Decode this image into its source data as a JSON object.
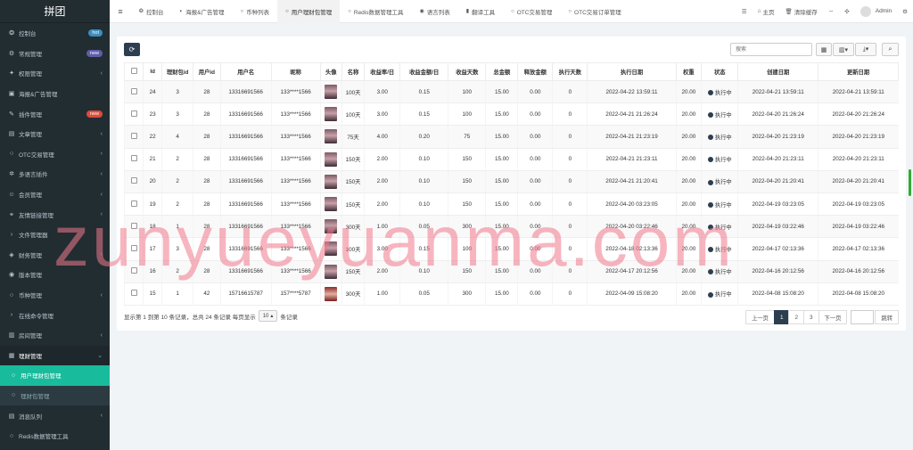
{
  "brand": "拼团",
  "sidebar": [
    {
      "icon": "dashboard-icon",
      "glyph": "❂",
      "label": "控制台",
      "badge": "hot",
      "badge_color": "#3c8dbc",
      "chev": ""
    },
    {
      "icon": "gear-icon",
      "glyph": "⚙",
      "label": "常规管理",
      "badge": "new",
      "badge_color": "#605ca8",
      "chev": ""
    },
    {
      "icon": "group-icon",
      "glyph": "✦",
      "label": "权限管理",
      "badge": "",
      "chev": "‹"
    },
    {
      "icon": "ad-icon",
      "glyph": "▣",
      "label": "海报&广告管理",
      "badge": "",
      "chev": ""
    },
    {
      "icon": "plug-icon",
      "glyph": "✎",
      "label": "插件管理",
      "badge": "new",
      "badge_color": "#dd4b39",
      "chev": ""
    },
    {
      "icon": "file-icon",
      "glyph": "▤",
      "label": "文章管理",
      "badge": "",
      "chev": "‹"
    },
    {
      "icon": "circle-icon",
      "glyph": "○",
      "label": "OTC交易管理",
      "badge": "",
      "chev": "‹"
    },
    {
      "icon": "translate-icon",
      "glyph": "✲",
      "label": "多语言插件",
      "badge": "",
      "chev": "‹"
    },
    {
      "icon": "user-icon",
      "glyph": "☺",
      "label": "会员管理",
      "badge": "",
      "chev": "‹"
    },
    {
      "icon": "link-icon",
      "glyph": "⚭",
      "label": "友情链接管理",
      "badge": "",
      "chev": "‹"
    },
    {
      "icon": "folder-icon",
      "glyph": "›",
      "label": "文件管理器",
      "badge": "",
      "chev": ""
    },
    {
      "icon": "wallet-icon",
      "glyph": "◈",
      "label": "财务管理",
      "badge": "",
      "chev": "‹"
    },
    {
      "icon": "version-icon",
      "glyph": "◉",
      "label": "版本管理",
      "badge": "",
      "chev": ""
    },
    {
      "icon": "coin-icon",
      "glyph": "○",
      "label": "币种管理",
      "badge": "",
      "chev": "‹"
    },
    {
      "icon": "terminal-icon",
      "glyph": "›",
      "label": "在线命令管理",
      "badge": "",
      "chev": ""
    },
    {
      "icon": "house-icon",
      "glyph": "▥",
      "label": "房间管理",
      "badge": "",
      "chev": "‹"
    },
    {
      "icon": "finance-icon",
      "glyph": "▦",
      "label": "理财管理",
      "badge": "",
      "chev": "⌄",
      "cls": "header-open"
    },
    {
      "icon": "circle-icon",
      "glyph": "○",
      "label": "用户理财包管理",
      "badge": "",
      "chev": "",
      "cls": "sub active"
    },
    {
      "icon": "circle-icon",
      "glyph": "○",
      "label": "理财包管理",
      "badge": "",
      "chev": "",
      "cls": "sub"
    },
    {
      "icon": "queue-icon",
      "glyph": "▤",
      "label": "消息队列",
      "badge": "",
      "chev": "‹"
    },
    {
      "icon": "circle-icon",
      "glyph": "○",
      "label": "Redis数据管理工具",
      "badge": "",
      "chev": ""
    }
  ],
  "tabs": [
    {
      "icon": "dashboard-icon",
      "glyph": "❂",
      "label": "控制台"
    },
    {
      "icon": "ad-icon",
      "glyph": "◐",
      "label": "海报&广告管理"
    },
    {
      "icon": "circle-icon",
      "glyph": "○",
      "label": "币种列表"
    },
    {
      "icon": "circle-icon",
      "glyph": "○",
      "label": "用户理财包管理",
      "active": true
    },
    {
      "icon": "circle-icon",
      "glyph": "○",
      "label": "Redis数据管理工具"
    },
    {
      "icon": "translate-icon",
      "glyph": "◉",
      "label": "语言列表"
    },
    {
      "icon": "book-icon",
      "glyph": "▮",
      "label": "翻译工具"
    },
    {
      "icon": "circle-icon",
      "glyph": "○",
      "label": "OTC交易管理"
    },
    {
      "icon": "circle-icon",
      "glyph": "○",
      "label": "OTC交易订单管理"
    }
  ],
  "topright": {
    "menu_glyph": "☰",
    "home": "主页",
    "clear": "清除缓存",
    "user": "Admin"
  },
  "search_placeholder": "搜索",
  "columns": [
    "Id",
    "理财包id",
    "用户id",
    "用户名",
    "昵称",
    "头像",
    "名称",
    "收益率/日",
    "收益金额/日",
    "收益天数",
    "总金额",
    "释放金额",
    "执行天数",
    "执行日期",
    "权重",
    "状态",
    "创建日期",
    "更新日期"
  ],
  "rows": [
    [
      "24",
      "3",
      "28",
      "13316691566",
      "133****1566",
      "",
      "100天",
      "3.00",
      "0.15",
      "100",
      "15.00",
      "0.00",
      "0",
      "2022-04-22 13:59:11",
      "20.00",
      "执行中",
      "2022-04-21 13:59:11",
      "2022-04-21 13:59:11"
    ],
    [
      "23",
      "3",
      "28",
      "13316691566",
      "133****1566",
      "",
      "100天",
      "3.00",
      "0.15",
      "100",
      "15.00",
      "0.00",
      "0",
      "2022-04-21 21:26:24",
      "20.00",
      "执行中",
      "2022-04-20 21:26:24",
      "2022-04-20 21:26:24"
    ],
    [
      "22",
      "4",
      "28",
      "13316691566",
      "133****1566",
      "",
      "75天",
      "4.00",
      "0.20",
      "75",
      "15.00",
      "0.00",
      "0",
      "2022-04-21 21:23:19",
      "20.00",
      "执行中",
      "2022-04-20 21:23:19",
      "2022-04-20 21:23:19"
    ],
    [
      "21",
      "2",
      "28",
      "13316691566",
      "133****1566",
      "",
      "150天",
      "2.00",
      "0.10",
      "150",
      "15.00",
      "0.00",
      "0",
      "2022-04-21 21:23:11",
      "20.00",
      "执行中",
      "2022-04-20 21:23:11",
      "2022-04-20 21:23:11"
    ],
    [
      "20",
      "2",
      "28",
      "13316691566",
      "133****1566",
      "",
      "150天",
      "2.00",
      "0.10",
      "150",
      "15.00",
      "0.00",
      "0",
      "2022-04-21 21:20:41",
      "20.00",
      "执行中",
      "2022-04-20 21:20:41",
      "2022-04-20 21:20:41"
    ],
    [
      "19",
      "2",
      "28",
      "13316691566",
      "133****1566",
      "",
      "150天",
      "2.00",
      "0.10",
      "150",
      "15.00",
      "0.00",
      "0",
      "2022-04-20 03:23:05",
      "20.00",
      "执行中",
      "2022-04-19 03:23:05",
      "2022-04-19 03:23:05"
    ],
    [
      "18",
      "1",
      "28",
      "13316691566",
      "133****1566",
      "",
      "300天",
      "1.00",
      "0.05",
      "300",
      "15.00",
      "0.00",
      "0",
      "2022-04-20 03:22:46",
      "20.00",
      "执行中",
      "2022-04-19 03:22:46",
      "2022-04-19 03:22:46"
    ],
    [
      "17",
      "3",
      "28",
      "13316691566",
      "133****1566",
      "",
      "100天",
      "3.00",
      "0.15",
      "100",
      "15.00",
      "0.00",
      "0",
      "2022-04-18 02:13:36",
      "20.00",
      "执行中",
      "2022-04-17 02:13:36",
      "2022-04-17 02:13:36"
    ],
    [
      "16",
      "2",
      "28",
      "13316691566",
      "133****1566",
      "",
      "150天",
      "2.00",
      "0.10",
      "150",
      "15.00",
      "0.00",
      "0",
      "2022-04-17 20:12:56",
      "20.00",
      "执行中",
      "2022-04-16 20:12:56",
      "2022-04-16 20:12:56"
    ],
    [
      "15",
      "1",
      "42",
      "15716615787",
      "157****5787",
      "",
      "300天",
      "1.00",
      "0.05",
      "300",
      "15.00",
      "0.00",
      "0",
      "2022-04-09 15:08:20",
      "20.00",
      "执行中",
      "2022-04-08 15:08:20",
      "2022-04-08 15:08:20"
    ]
  ],
  "footer": {
    "info": "显示第 1 到第 10 条记录，总共 24 条记录 每页显示",
    "page_size": "10",
    "suffix": "条记录"
  },
  "pager": {
    "prev": "上一页",
    "pages": [
      "1",
      "2",
      "3"
    ],
    "next": "下一页",
    "jump": "跳转"
  },
  "watermark": "zunyueyuanma.com"
}
